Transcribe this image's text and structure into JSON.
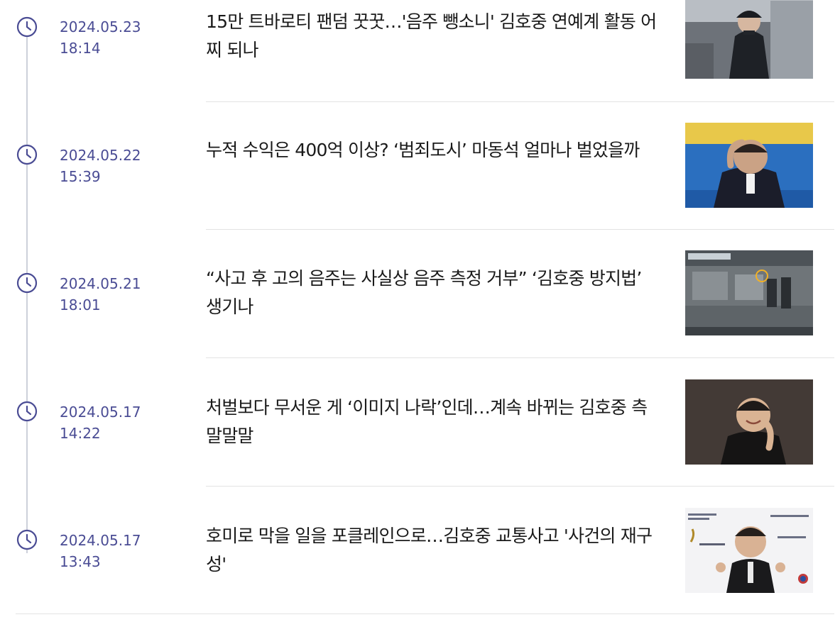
{
  "news": {
    "items": [
      {
        "date": "2024.05.23",
        "time": "18:14",
        "headline": "15만 트바로티 팬덤 꿋꿋…'음주 뺑소니' 김호중 연예계 활동 어찌 되나"
      },
      {
        "date": "2024.05.22",
        "time": "15:39",
        "headline": "누적 수익은 400억 이상? ‘범죄도시’ 마동석 얼마나 벌었을까"
      },
      {
        "date": "2024.05.21",
        "time": "18:01",
        "headline": "“사고 후 고의 음주는 사실상 음주 측정 거부” ‘김호중 방지법’ 생기나"
      },
      {
        "date": "2024.05.17",
        "time": "14:22",
        "headline": "처벌보다 무서운 게 ‘이미지 나락’인데…계속 바뀌는 김호중 측 말말말"
      },
      {
        "date": "2024.05.17",
        "time": "13:43",
        "headline": "호미로 막을 일을 포클레인으로…김호중 교통사고 '사건의 재구성'"
      }
    ]
  },
  "colors": {
    "accent": "#4a4c94",
    "headline": "#1a1a1a",
    "timeline": "#cdd0da",
    "divider": "#e3e3e3"
  },
  "icons": {
    "timestamp": "clock-icon"
  }
}
